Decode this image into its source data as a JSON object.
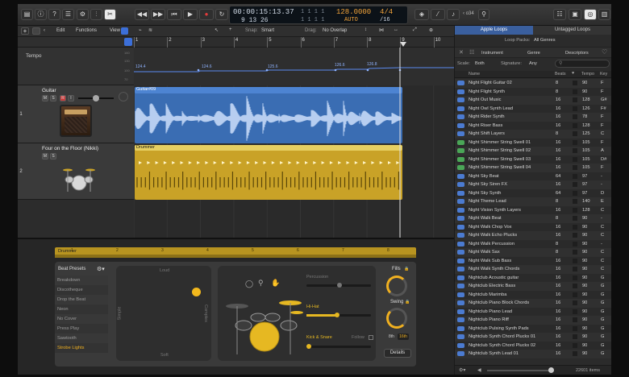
{
  "control_bar": {
    "lcd": {
      "position_time": "00:00:15:13.37",
      "position_bars": "9  13  26",
      "bar_beat_top": "1  1  1  1",
      "bar_beat_bottom": "1  1  1  1",
      "tempo": "128.0000",
      "tempo_mode": "AUTO",
      "signature": "4/4",
      "division": "/16"
    },
    "project_label": "‹ o34"
  },
  "track_toolbar": {
    "edit": "Edit",
    "functions": "Functions",
    "view": "View",
    "snap_label": "Snap:",
    "snap_value": "Smart",
    "drag_label": "Drag:",
    "drag_value": "No Overlap"
  },
  "ruler": {
    "bars": [
      "1",
      "2",
      "3",
      "4",
      "5",
      "6",
      "7",
      "8",
      "9",
      "10"
    ]
  },
  "tempo_track": {
    "label": "Tempo",
    "values": [
      "124.4",
      "124.6",
      "125.6",
      "126.6",
      "126.8"
    ],
    "scale": [
      "160",
      "130",
      "100",
      "70"
    ]
  },
  "tracks": [
    {
      "number": "1",
      "name": "Guitar",
      "region": "Guitar#09",
      "color": "#3a6db3"
    },
    {
      "number": "2",
      "name": "Four on the Floor (Nikki)",
      "region": "Drummer",
      "color": "#c9a227"
    }
  ],
  "buttons": {
    "m": "M",
    "s": "S",
    "r": "R",
    "i": "I"
  },
  "loops_browser": {
    "tabs": [
      "Apple Loops",
      "Untagged Loops"
    ],
    "loop_packs_label": "Loop Packs:",
    "loop_packs_value": "All Genres",
    "category_tabs": [
      "Instrument",
      "Genre",
      "Descriptors"
    ],
    "scale_label": "Scale:",
    "scale_value": "Both",
    "signature_label": "Signature:",
    "signature_value": "Any",
    "columns": {
      "name": "Name",
      "beats": "Beats",
      "tempo": "Tempo",
      "key": "Key"
    },
    "items_count": "22601 items",
    "rows": [
      {
        "name": "Night Flight Guitar 02",
        "beats": "8",
        "tempo": "90",
        "key": "F",
        "type": "audio"
      },
      {
        "name": "Night Flight Synth",
        "beats": "8",
        "tempo": "90",
        "key": "F",
        "type": "audio"
      },
      {
        "name": "Night Out Music",
        "beats": "16",
        "tempo": "128",
        "key": "G#",
        "type": "audio"
      },
      {
        "name": "Night Owl Synth Lead",
        "beats": "16",
        "tempo": "126",
        "key": "F#",
        "type": "audio"
      },
      {
        "name": "Night Rider Synth",
        "beats": "16",
        "tempo": "78",
        "key": "F",
        "type": "audio"
      },
      {
        "name": "Night Riser Bass",
        "beats": "16",
        "tempo": "128",
        "key": "F",
        "type": "audio"
      },
      {
        "name": "Night Shift Layers",
        "beats": "8",
        "tempo": "125",
        "key": "C",
        "type": "audio"
      },
      {
        "name": "Night Shimmer String Swell 01",
        "beats": "16",
        "tempo": "105",
        "key": "F",
        "type": "midi"
      },
      {
        "name": "Night Shimmer String Swell 02",
        "beats": "16",
        "tempo": "105",
        "key": "A",
        "type": "midi"
      },
      {
        "name": "Night Shimmer String Swell 03",
        "beats": "16",
        "tempo": "105",
        "key": "D#",
        "type": "midi"
      },
      {
        "name": "Night Shimmer String Swell 04",
        "beats": "16",
        "tempo": "105",
        "key": "F",
        "type": "midi"
      },
      {
        "name": "Night Sky Beat",
        "beats": "64",
        "tempo": "97",
        "key": "-",
        "type": "audio"
      },
      {
        "name": "Night Sky Siren FX",
        "beats": "16",
        "tempo": "97",
        "key": "-",
        "type": "audio"
      },
      {
        "name": "Night Sky Synth",
        "beats": "64",
        "tempo": "97",
        "key": "D",
        "type": "audio"
      },
      {
        "name": "Night Theme Lead",
        "beats": "8",
        "tempo": "140",
        "key": "E",
        "type": "audio"
      },
      {
        "name": "Night Vision Synth Layers",
        "beats": "16",
        "tempo": "128",
        "key": "C",
        "type": "audio"
      },
      {
        "name": "Night Walk Beat",
        "beats": "8",
        "tempo": "90",
        "key": "-",
        "type": "audio"
      },
      {
        "name": "Night Walk Chop Vox",
        "beats": "16",
        "tempo": "90",
        "key": "C",
        "type": "audio"
      },
      {
        "name": "Night Walk Echo Plucks",
        "beats": "16",
        "tempo": "90",
        "key": "C",
        "type": "audio"
      },
      {
        "name": "Night Walk Percussion",
        "beats": "8",
        "tempo": "90",
        "key": "-",
        "type": "audio"
      },
      {
        "name": "Night Walk Sax",
        "beats": "8",
        "tempo": "90",
        "key": "C",
        "type": "audio"
      },
      {
        "name": "Night Walk Sub Bass",
        "beats": "16",
        "tempo": "90",
        "key": "C",
        "type": "audio"
      },
      {
        "name": "Night Walk Synth Chords",
        "beats": "16",
        "tempo": "90",
        "key": "C",
        "type": "audio"
      },
      {
        "name": "Nightclub Acoustic guitar",
        "beats": "16",
        "tempo": "90",
        "key": "G",
        "type": "audio"
      },
      {
        "name": "Nightclub Electric Bass",
        "beats": "16",
        "tempo": "90",
        "key": "G",
        "type": "audio"
      },
      {
        "name": "Nightclub Marimba",
        "beats": "16",
        "tempo": "90",
        "key": "G",
        "type": "audio"
      },
      {
        "name": "Nightclub Piano Block Chords",
        "beats": "16",
        "tempo": "90",
        "key": "G",
        "type": "audio"
      },
      {
        "name": "Nightclub Piano Lead",
        "beats": "16",
        "tempo": "90",
        "key": "G",
        "type": "audio"
      },
      {
        "name": "Nightclub Piano Riff",
        "beats": "16",
        "tempo": "90",
        "key": "G",
        "type": "audio"
      },
      {
        "name": "Nightclub Pulsing Synth Pads",
        "beats": "16",
        "tempo": "90",
        "key": "G",
        "type": "audio"
      },
      {
        "name": "Nightclub Synth Chord Plucks 01",
        "beats": "16",
        "tempo": "90",
        "key": "G",
        "type": "audio"
      },
      {
        "name": "Nightclub Synth Chord Plucks 02",
        "beats": "16",
        "tempo": "90",
        "key": "G",
        "type": "audio"
      },
      {
        "name": "Nightclub Synth Lead 01",
        "beats": "16",
        "tempo": "90",
        "key": "G",
        "type": "audio"
      }
    ]
  },
  "drummer_editor": {
    "region_label": "Drummer",
    "ruler": [
      "1",
      "2",
      "3",
      "4",
      "5",
      "6",
      "7",
      "8"
    ],
    "beat_presets_label": "Beat Presets",
    "presets": [
      "Breakdown",
      "Discotheque",
      "Drop the Beat",
      "Neon",
      "No Cover",
      "Press Play",
      "Sawtooth",
      "Strobe Lights"
    ],
    "selected_preset": "Strobe Lights",
    "xy_labels": {
      "loud": "Loud",
      "soft": "Soft",
      "simple": "Simple",
      "complex": "Complex"
    },
    "percussion": "Percussion",
    "hi_hat": "Hi-Hat",
    "kick_snare": "Kick & Snare",
    "follow": "Follow",
    "fills": "Fills",
    "swing": "Swing",
    "eighth": "8th",
    "sixteenth": "16th",
    "details": "Details"
  },
  "colors": {
    "accent_blue": "#4b7bd1",
    "drummer_yellow": "#c9a227",
    "knob_orange": "#f0b020"
  }
}
